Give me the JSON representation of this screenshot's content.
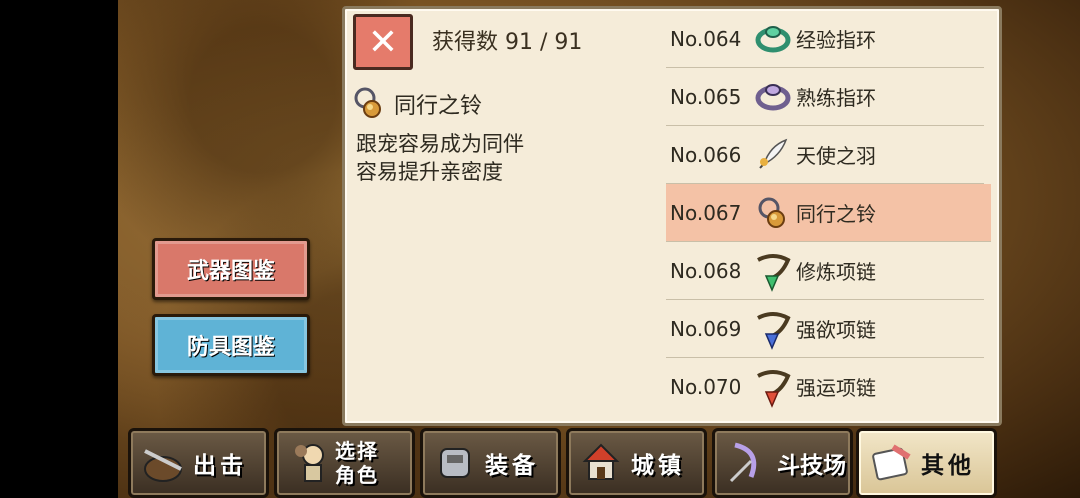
{
  "panel": {
    "close_symbol": "✕",
    "count_label": "获得数 91 / 91"
  },
  "detail": {
    "name": "同行之铃",
    "desc_lines": [
      "跟宠容易成为同伴",
      "容易提升亲密度"
    ]
  },
  "side_buttons": {
    "weapon": "武器图鉴",
    "armor": "防具图鉴"
  },
  "list": [
    {
      "no": "No.064",
      "name": "经验指环",
      "icon": "ring-green-icon"
    },
    {
      "no": "No.065",
      "name": "熟练指环",
      "icon": "ring-purple-icon"
    },
    {
      "no": "No.066",
      "name": "天使之羽",
      "icon": "feather-icon"
    },
    {
      "no": "No.067",
      "name": "同行之铃",
      "icon": "bell-icon",
      "selected": true
    },
    {
      "no": "No.068",
      "name": "修炼项链",
      "icon": "necklace-green-icon"
    },
    {
      "no": "No.069",
      "name": "强欲项链",
      "icon": "necklace-blue-icon"
    },
    {
      "no": "No.070",
      "name": "强运项链",
      "icon": "necklace-red-icon"
    }
  ],
  "tabs": [
    {
      "label": "出击",
      "icon": "sortie-icon"
    },
    {
      "label_lines": [
        "选择",
        "角色"
      ],
      "icon": "character-icon"
    },
    {
      "label": "装备",
      "icon": "armor-icon"
    },
    {
      "label": "城镇",
      "icon": "town-icon"
    },
    {
      "label": "斗技场",
      "icon": "arena-icon"
    },
    {
      "label": "其他",
      "icon": "scroll-icon",
      "active": true
    }
  ]
}
